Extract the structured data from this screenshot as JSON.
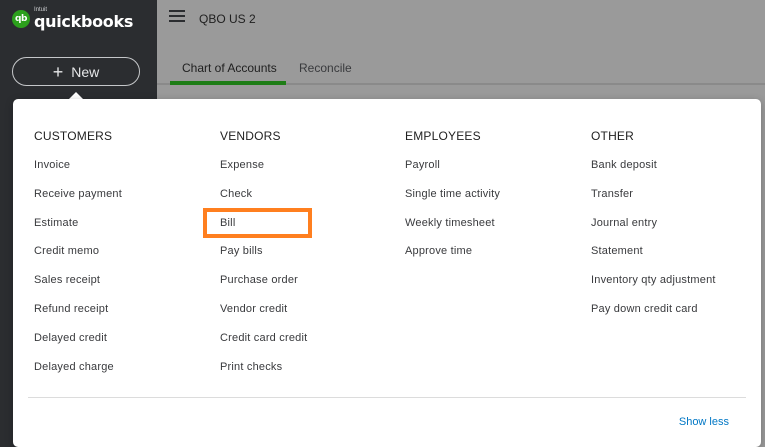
{
  "brand": {
    "sub": "Intuit",
    "name": "quickbooks",
    "mark": "qb"
  },
  "new_button": {
    "label": "New"
  },
  "header": {
    "company": "QBO US 2"
  },
  "tabs": [
    {
      "label": "Chart of Accounts",
      "active": true
    },
    {
      "label": "Reconcile",
      "active": false
    }
  ],
  "menu": {
    "columns": [
      {
        "heading": "CUSTOMERS",
        "items": [
          "Invoice",
          "Receive payment",
          "Estimate",
          "Credit memo",
          "Sales receipt",
          "Refund receipt",
          "Delayed credit",
          "Delayed charge"
        ]
      },
      {
        "heading": "VENDORS",
        "items": [
          "Expense",
          "Check",
          "Bill",
          "Pay bills",
          "Purchase order",
          "Vendor credit",
          "Credit card credit",
          "Print checks"
        ]
      },
      {
        "heading": "EMPLOYEES",
        "items": [
          "Payroll",
          "Single time activity",
          "Weekly timesheet",
          "Approve time"
        ]
      },
      {
        "heading": "OTHER",
        "items": [
          "Bank deposit",
          "Transfer",
          "Journal entry",
          "Statement",
          "Inventory qty adjustment",
          "Pay down credit card"
        ]
      }
    ],
    "show_less": "Show less"
  },
  "colors": {
    "accent": "#2ca01c",
    "highlight": "#ff7f1f",
    "link": "#0077c5"
  }
}
